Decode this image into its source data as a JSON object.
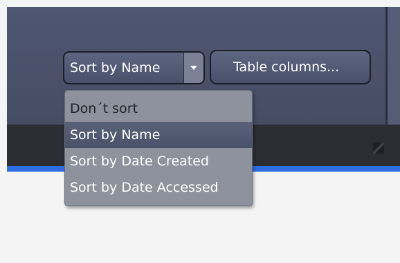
{
  "sort_select": {
    "value": "Sort by Name",
    "dropdown_icon": "chevron-down-icon"
  },
  "table_columns_button": {
    "label": "Table columns..."
  },
  "sort_menu": {
    "items": [
      {
        "label": "Don´t sort"
      },
      {
        "label": "Sort by Name",
        "selected": true
      },
      {
        "label": "Sort by Date Created"
      },
      {
        "label": "Sort by Date Accessed"
      }
    ]
  },
  "colors": {
    "panel": "#4a5169",
    "status_bar": "#2b2d33",
    "accent": "#2f6de2",
    "menu": "#8d929c",
    "menu_selected": "#525a72"
  }
}
